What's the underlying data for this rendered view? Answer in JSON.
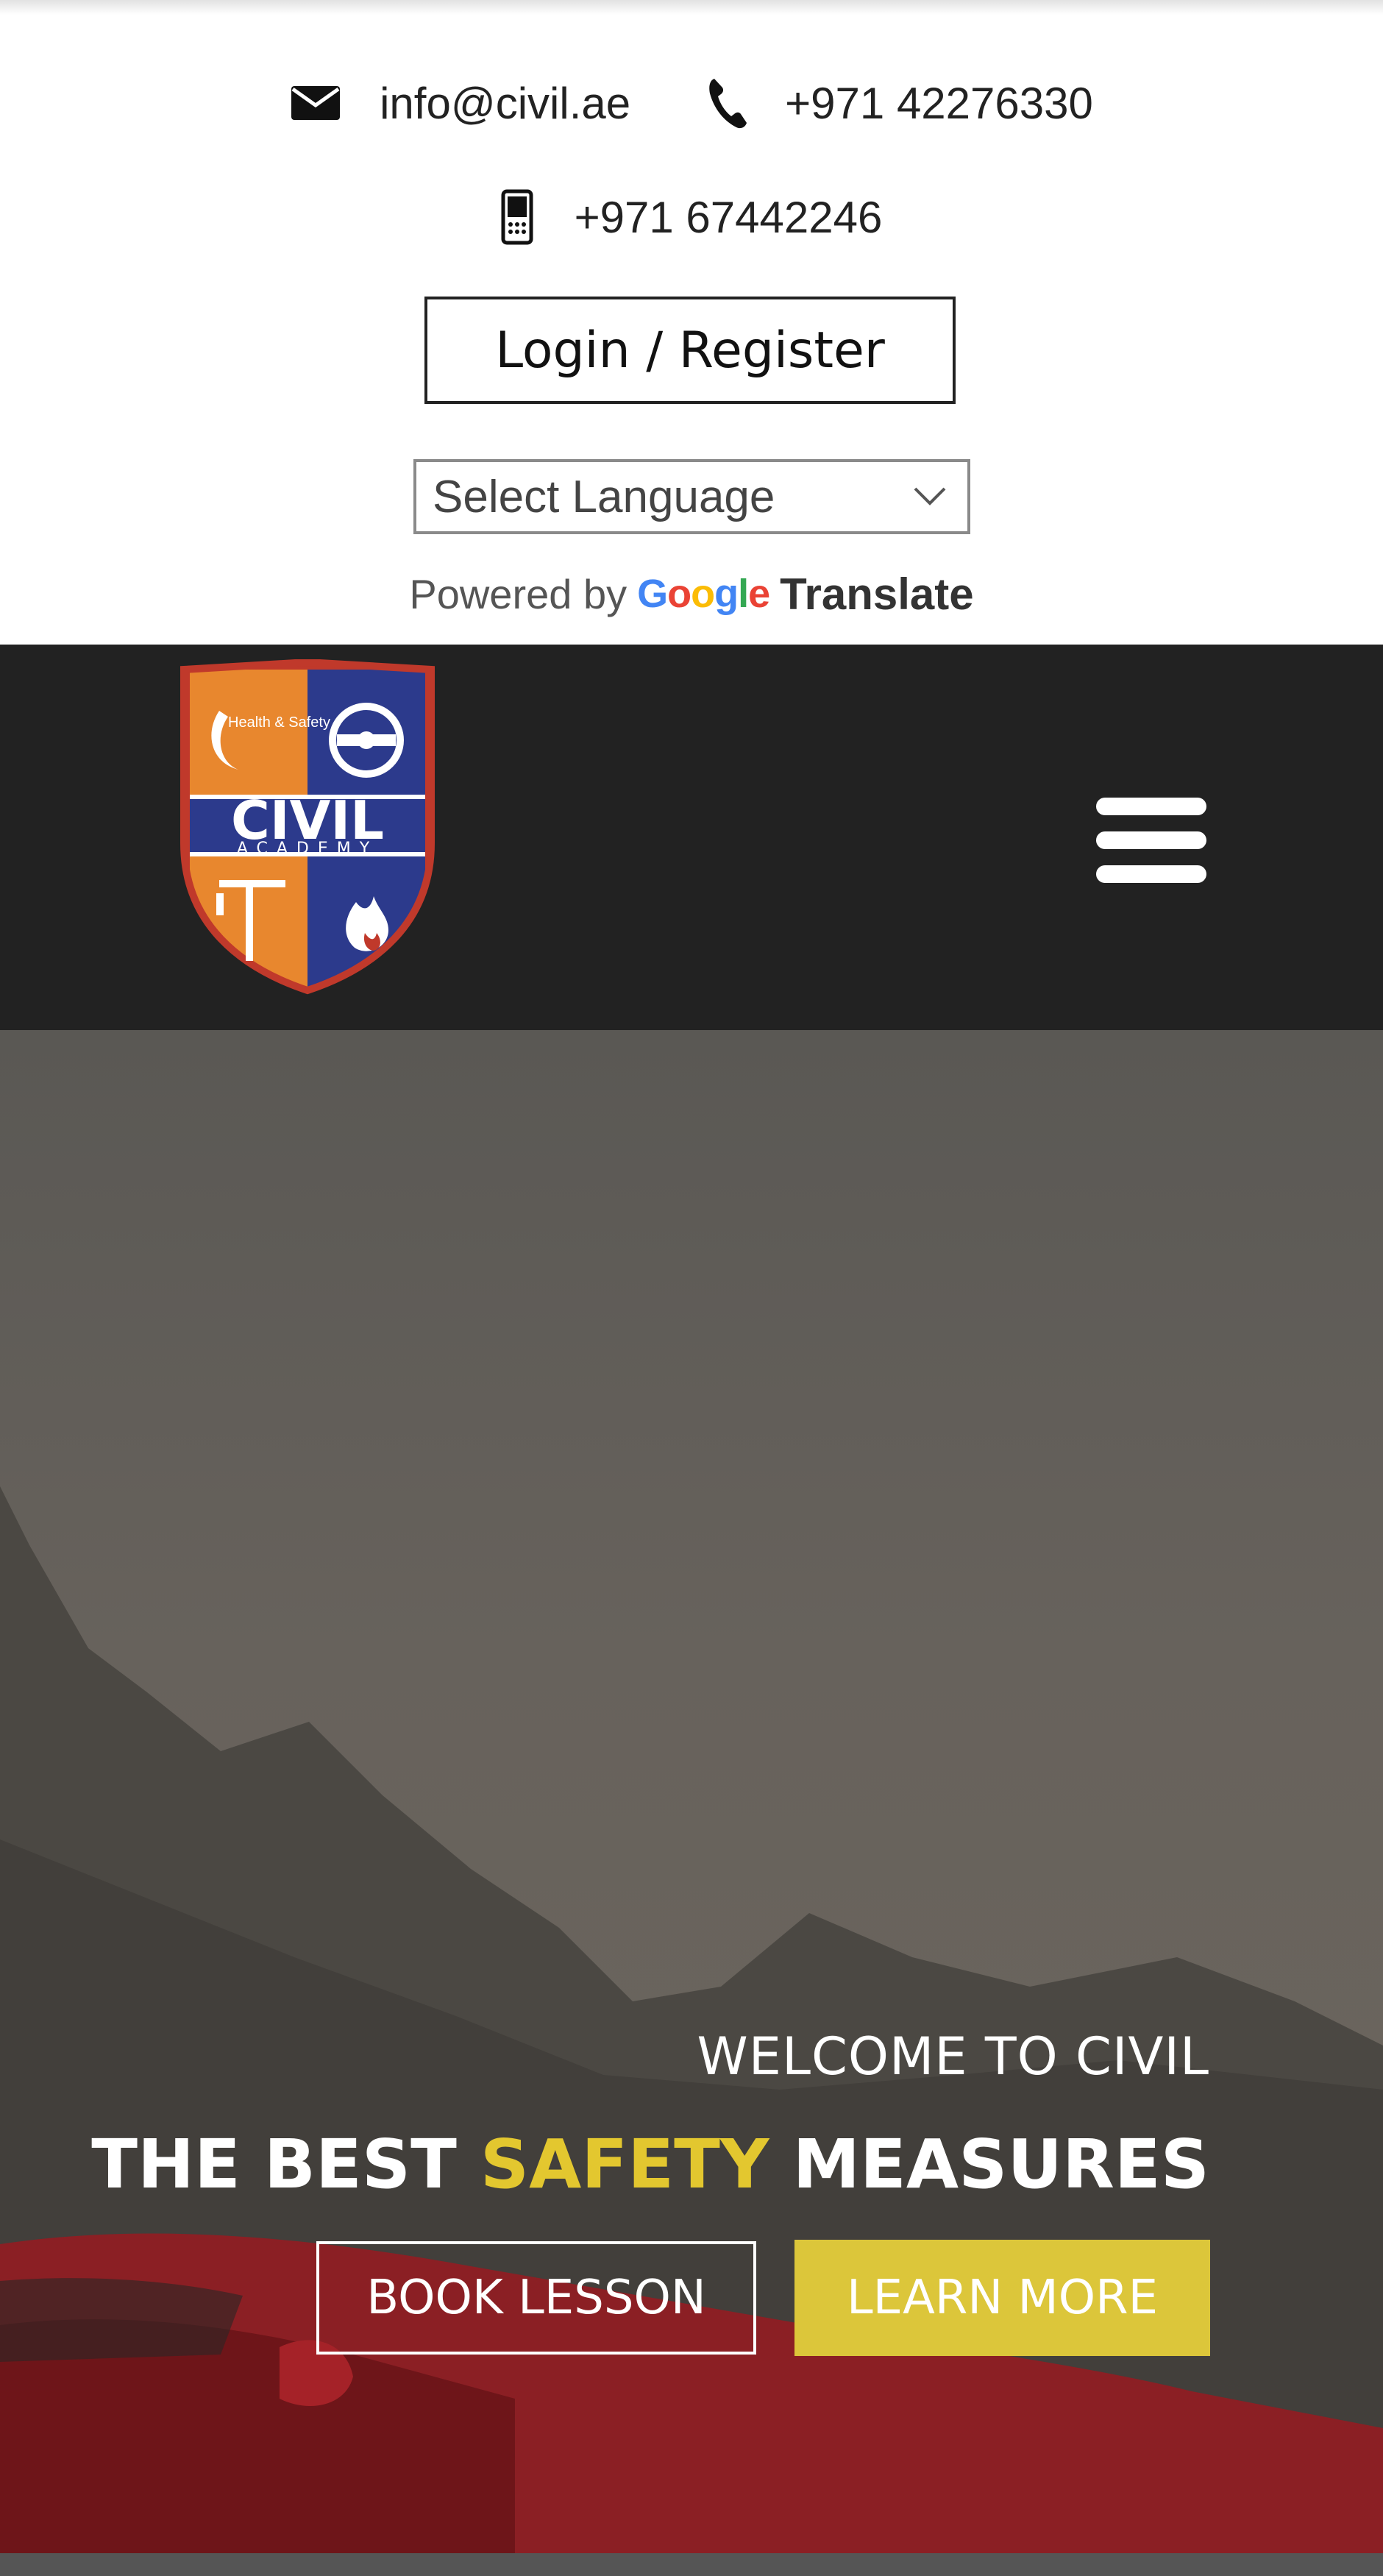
{
  "contacts": {
    "email": "info@civil.ae",
    "phone": "+971 42276330",
    "mobile": "+971 67442246"
  },
  "auth": {
    "login_label": "Login / Register"
  },
  "language": {
    "select_label": "Select Language",
    "powered_by": "Powered by",
    "google": "Google",
    "translate": "Translate"
  },
  "logo": {
    "top_left": "Health & Safety",
    "name": "CIVIL",
    "subtitle": "ACADEMY"
  },
  "icons": {
    "email": "envelope-icon",
    "phone": "phone-icon",
    "mobile": "mobile-phone-icon",
    "menu": "hamburger-menu-icon",
    "dropdown": "chevron-down-icon"
  },
  "hero": {
    "welcome": "WELCOME TO CIVIL",
    "headline_prefix": "THE BEST ",
    "headline_accent": "SAFETY",
    "headline_suffix": " MEASURES",
    "book_label": "BOOK LESSON",
    "learn_label": "LEARN MORE"
  },
  "colors": {
    "navbar_bg": "#222222",
    "accent_yellow": "#dcc63a",
    "headline_accent": "#e3c72f"
  }
}
